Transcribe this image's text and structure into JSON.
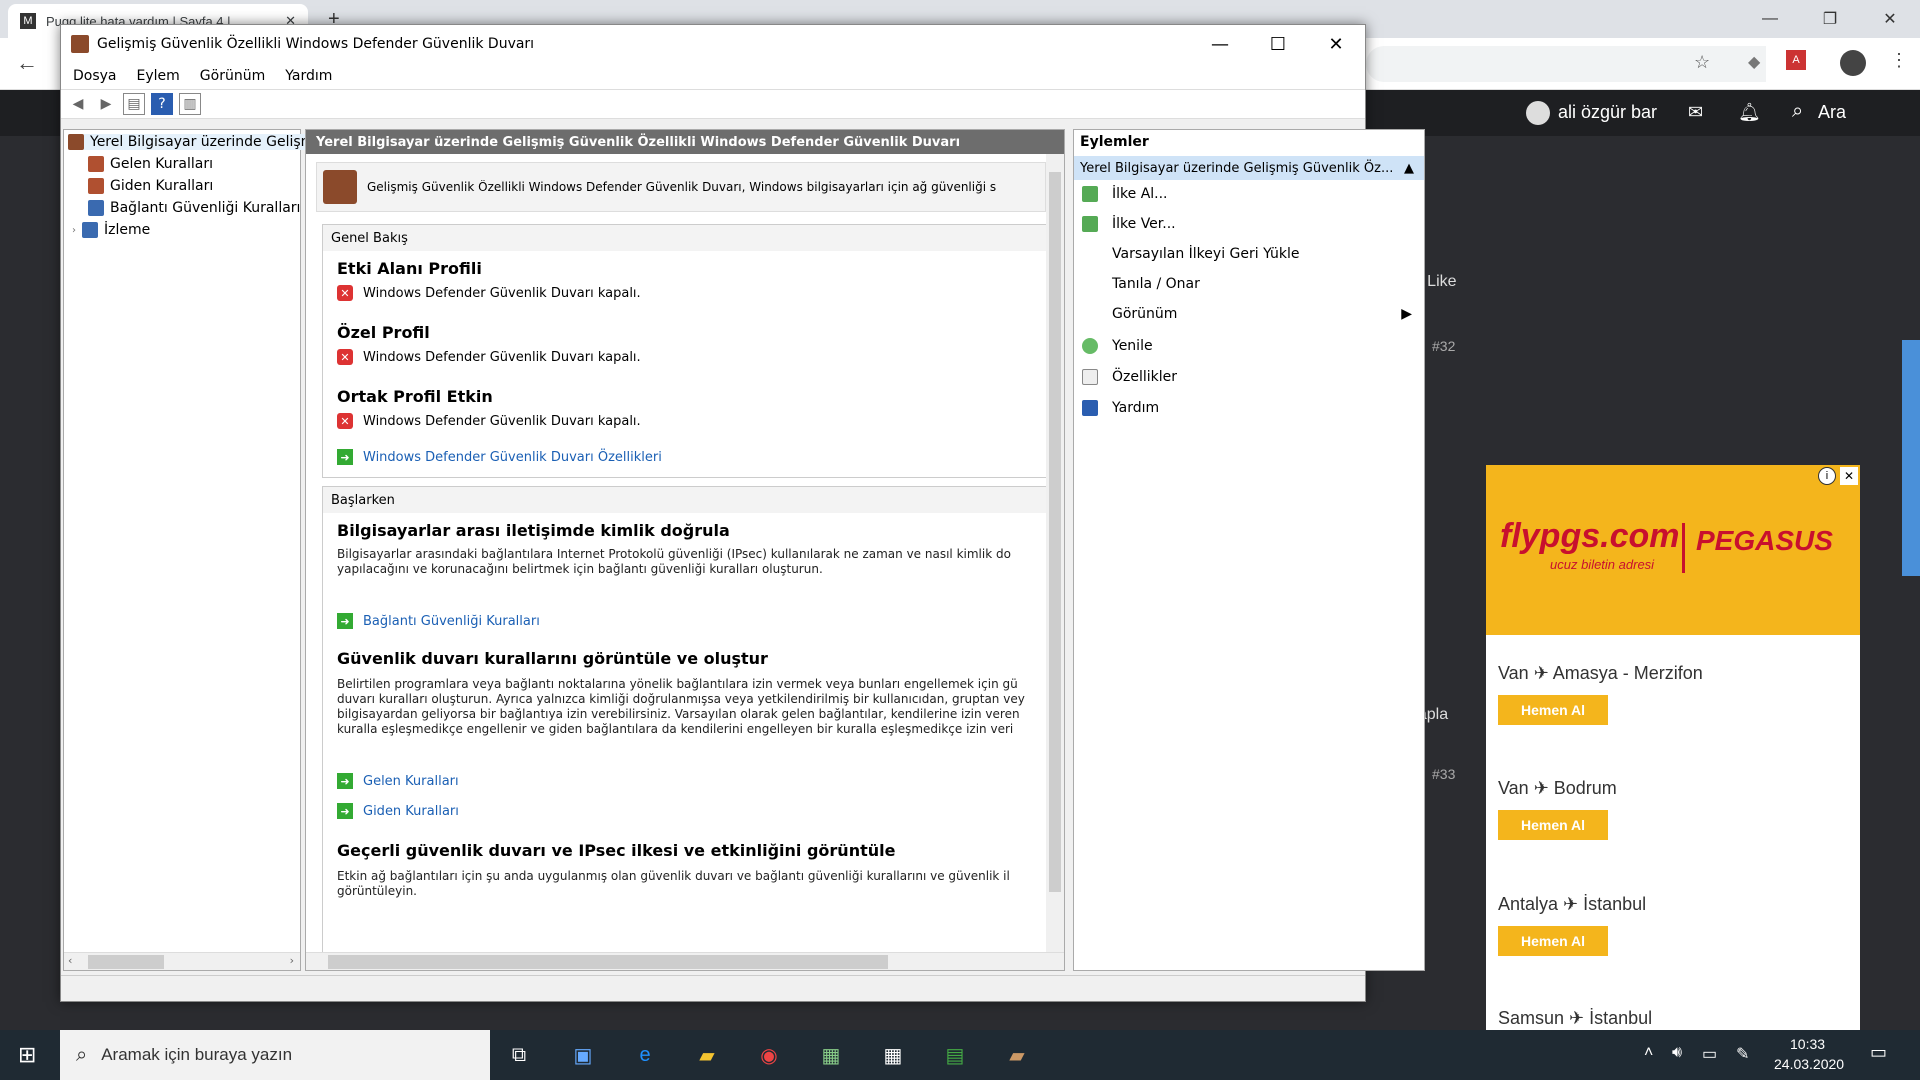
{
  "browser": {
    "tab_title": "Pugg lite hata vardım | Sayfa 4 |",
    "user_name": "ali özgür bar",
    "search_label": "Ara",
    "like_label": "Like",
    "post_32": "#32",
    "post_33": "#33",
    "reply_label": "Cevapla"
  },
  "ad": {
    "brand": "flypgs.com",
    "brand2": "PEGASUS",
    "tagline": "ucuz biletin adresi",
    "routes": [
      {
        "label": "Van ✈ Amasya - Merzifon",
        "btn": "Hemen Al"
      },
      {
        "label": "Van ✈ Bodrum",
        "btn": "Hemen Al"
      },
      {
        "label": "Antalya ✈ İstanbul",
        "btn": "Hemen Al"
      },
      {
        "label": "Samsun ✈ İstanbul"
      }
    ]
  },
  "taskbar": {
    "search_placeholder": "Aramak için buraya yazın",
    "time": "10:33",
    "date": "24.03.2020"
  },
  "window": {
    "title": "Gelişmiş Güvenlik Özellikli Windows Defender Güvenlik Duvarı",
    "menu": [
      "Dosya",
      "Eylem",
      "Görünüm",
      "Yardım"
    ]
  },
  "tree": {
    "root": "Yerel Bilgisayar üzerinde Gelişm",
    "items": [
      "Gelen Kuralları",
      "Giden Kuralları",
      "Bağlantı Güvenliği Kuralları",
      "İzleme"
    ]
  },
  "center": {
    "header": "Yerel Bilgisayar üzerinde Gelişmiş Güvenlik Özellikli Windows Defender Güvenlik Duvarı",
    "intro": "Gelişmiş Güvenlik Özellikli Windows Defender Güvenlik Duvarı, Windows bilgisayarları için ağ güvenliği s",
    "overview_title": "Genel Bakış",
    "profiles": [
      {
        "name": "Etki Alanı Profili",
        "status": "Windows Defender Güvenlik Duvarı kapalı."
      },
      {
        "name": "Özel Profil",
        "status": "Windows Defender Güvenlik Duvarı kapalı."
      },
      {
        "name": "Ortak Profil Etkin",
        "status": "Windows Defender Güvenlik Duvarı kapalı."
      }
    ],
    "properties_link": "Windows Defender Güvenlik Duvarı Özellikleri",
    "start_title": "Başlarken",
    "auth_title": "Bilgisayarlar arası iletişimde kimlik doğrula",
    "auth_text": "Bilgisayarlar arasındaki bağlantılara Internet Protokolü güvenliği (IPsec) kullanılarak ne zaman ve nasıl kimlik do yapılacağını ve korunacağını belirtmek için bağlantı güvenliği kuralları oluşturun.",
    "auth_link": "Bağlantı Güvenliği Kuralları",
    "rules_title": "Güvenlik duvarı kurallarını görüntüle ve oluştur",
    "rules_text": "Belirtilen programlara veya bağlantı noktalarına yönelik bağlantılara izin vermek veya bunları engellemek için gü duvarı kuralları oluşturun. Ayrıca yalnızca kimliği doğrulanmışsa veya yetkilendirilmiş bir kullanıcıdan, gruptan vey bilgisayardan geliyorsa bir bağlantıya izin verebilirsiniz. Varsayılan olarak gelen bağlantılar, kendilerine izin veren kuralla eşleşmedikçe engellenir ve giden bağlantılara da kendilerini engelleyen bir kuralla eşleşmedikçe izin veri",
    "inbound_link": "Gelen Kuralları",
    "outbound_link": "Giden Kuralları",
    "policy_title": "Geçerli güvenlik duvarı ve IPsec ilkesi ve etkinliğini görüntüle",
    "policy_text": "Etkin ağ bağlantıları için şu anda uygulanmış olan güvenlik duvarı ve bağlantı güvenliği kurallarını ve güvenlik il görüntüleyin."
  },
  "actions": {
    "title": "Eylemler",
    "group": "Yerel Bilgisayar üzerinde Gelişmiş Güvenlik Öz...",
    "items": [
      "İlke Al...",
      "İlke Ver...",
      "Varsayılan İlkeyi Geri Yükle",
      "Tanıla / Onar",
      "Görünüm",
      "Yenile",
      "Özellikler",
      "Yardım"
    ]
  },
  "colors": {
    "accent": "#1a5fb4",
    "ad_yellow": "#f4b51c",
    "header_gray": "#6d6d6d"
  }
}
